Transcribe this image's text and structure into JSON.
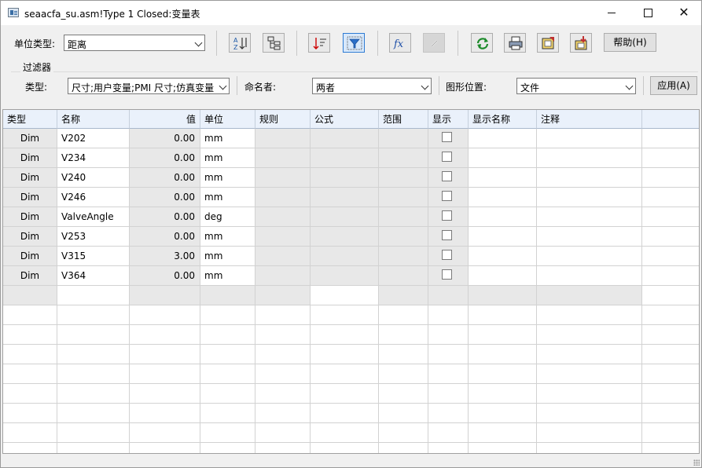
{
  "window": {
    "title": "seaacfa_su.asm!Type 1 Closed:变量表",
    "controls": {
      "minimize": "—",
      "maximize": "",
      "close": "✕"
    }
  },
  "toolbar": {
    "unit_type_label": "单位类型:",
    "unit_type_value": "距离",
    "icons": [
      "sort-az-icon",
      "tree-structure-icon",
      "sort-order-icon",
      "filter-icon",
      "formula-fx-icon",
      "edit-disabled-icon",
      "refresh-icon",
      "print-icon",
      "export-icon",
      "import-icon"
    ],
    "help_label": "帮助(H)"
  },
  "filter": {
    "group_label": "过滤器",
    "type_label": "类型:",
    "type_value": "尺寸;用户变量;PMI 尺寸;仿真变量",
    "named_by_label": "命名者:",
    "named_by_value": "两者",
    "graphic_position_label": "图形位置:",
    "graphic_position_value": "文件",
    "apply_label": "应用(A)"
  },
  "table": {
    "columns": [
      "类型",
      "名称",
      "值",
      "单位",
      "规则",
      "公式",
      "范围",
      "显示",
      "显示名称",
      "注释"
    ],
    "rows": [
      {
        "type": "Dim",
        "name": "V202",
        "value": "0.00",
        "unit": "mm",
        "show": false
      },
      {
        "type": "Dim",
        "name": "V234",
        "value": "0.00",
        "unit": "mm",
        "show": false
      },
      {
        "type": "Dim",
        "name": "V240",
        "value": "0.00",
        "unit": "mm",
        "show": false
      },
      {
        "type": "Dim",
        "name": "V246",
        "value": "0.00",
        "unit": "mm",
        "show": false
      },
      {
        "type": "Dim",
        "name": "ValveAngle",
        "value": "0.00",
        "unit": "deg",
        "show": false
      },
      {
        "type": "Dim",
        "name": "V253",
        "value": "0.00",
        "unit": "mm",
        "show": false
      },
      {
        "type": "Dim",
        "name": "V315",
        "value": "3.00",
        "unit": "mm",
        "show": false
      },
      {
        "type": "Dim",
        "name": "V364",
        "value": "0.00",
        "unit": "mm",
        "show": false
      }
    ]
  },
  "colors": {
    "header_bg": "#eaf1fb",
    "readonly_cell": "#e8e8e8",
    "active_button_border": "#2e7bd3"
  }
}
